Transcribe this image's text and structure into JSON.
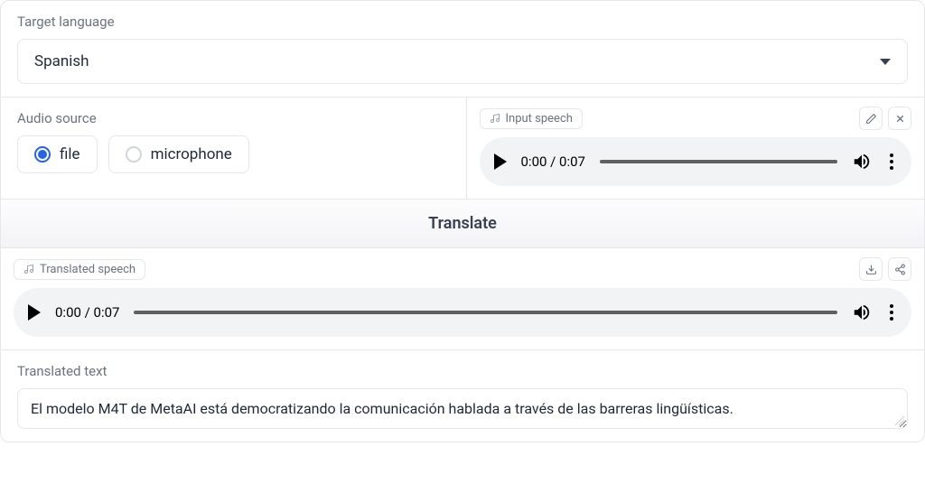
{
  "targetLanguage": {
    "label": "Target language",
    "value": "Spanish"
  },
  "audioSource": {
    "label": "Audio source",
    "options": {
      "file": "file",
      "microphone": "microphone"
    },
    "selected": "file"
  },
  "inputSpeech": {
    "label": "Input speech",
    "time": "0:00 / 0:07"
  },
  "translateButton": "Translate",
  "translatedSpeech": {
    "label": "Translated speech",
    "time": "0:00 / 0:07"
  },
  "translatedText": {
    "label": "Translated text",
    "value": "El modelo M4T de MetaAI está democratizando la comunicación hablada a través de las barreras lingüísticas."
  }
}
